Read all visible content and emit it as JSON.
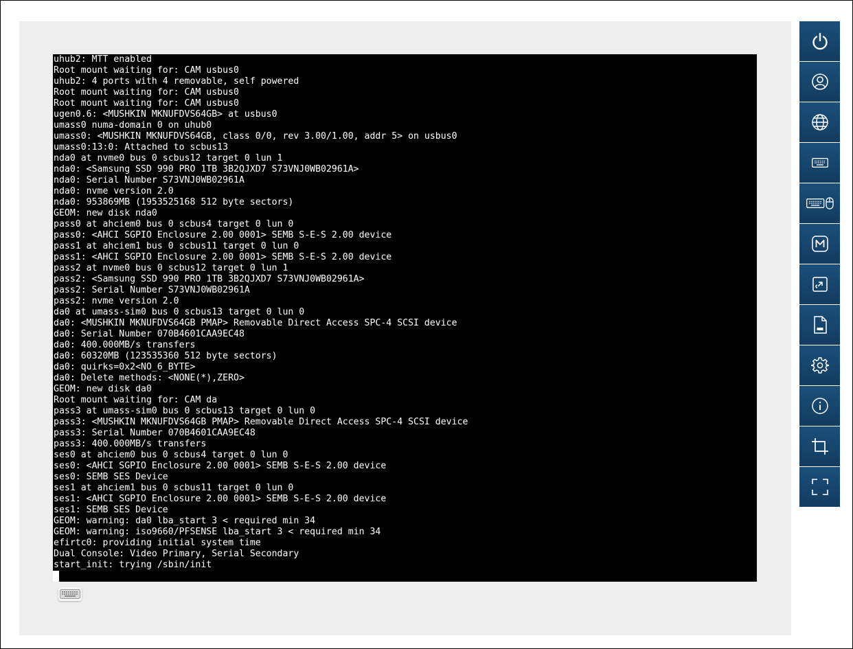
{
  "console": {
    "lines": [
      "uhub2: MTT enabled",
      "Root mount waiting for: CAM usbus0",
      "uhub2: 4 ports with 4 removable, self powered",
      "Root mount waiting for: CAM usbus0",
      "Root mount waiting for: CAM usbus0",
      "ugen0.6: <MUSHKIN MKNUFDVS64GB> at usbus0",
      "umass0 numa-domain 0 on uhub0",
      "umass0: <MUSHKIN MKNUFDVS64GB, class 0/0, rev 3.00/1.00, addr 5> on usbus0",
      "umass0:13:0: Attached to scbus13",
      "nda0 at nvme0 bus 0 scbus12 target 0 lun 1",
      "nda0: <Samsung SSD 990 PRO 1TB 3B2QJXD7 S73VNJ0WB02961A>",
      "nda0: Serial Number S73VNJ0WB02961A",
      "nda0: nvme version 2.0",
      "nda0: 953869MB (1953525168 512 byte sectors)",
      "GEOM: new disk nda0",
      "pass0 at ahciem0 bus 0 scbus4 target 0 lun 0",
      "pass0: <AHCI SGPIO Enclosure 2.00 0001> SEMB S-E-S 2.00 device",
      "pass1 at ahciem1 bus 0 scbus11 target 0 lun 0",
      "pass1: <AHCI SGPIO Enclosure 2.00 0001> SEMB S-E-S 2.00 device",
      "pass2 at nvme0 bus 0 scbus12 target 0 lun 1",
      "pass2: <Samsung SSD 990 PRO 1TB 3B2QJXD7 S73VNJ0WB02961A>",
      "pass2: Serial Number S73VNJ0WB02961A",
      "pass2: nvme version 2.0",
      "da0 at umass-sim0 bus 0 scbus13 target 0 lun 0",
      "da0: <MUSHKIN MKNUFDVS64GB PMAP> Removable Direct Access SPC-4 SCSI device",
      "da0: Serial Number 070B4601CAA9EC48",
      "da0: 400.000MB/s transfers",
      "da0: 60320MB (123535360 512 byte sectors)",
      "da0: quirks=0x2<NO_6_BYTE>",
      "da0: Delete methods: <NONE(*),ZERO>",
      "GEOM: new disk da0",
      "Root mount waiting for: CAM da",
      "pass3 at umass-sim0 bus 0 scbus13 target 0 lun 0",
      "pass3: <MUSHKIN MKNUFDVS64GB PMAP> Removable Direct Access SPC-4 SCSI device",
      "pass3: Serial Number 070B4601CAA9EC48",
      "pass3: 400.000MB/s transfers",
      "ses0 at ahciem0 bus 0 scbus4 target 0 lun 0",
      "ses0: <AHCI SGPIO Enclosure 2.00 0001> SEMB S-E-S 2.00 device",
      "ses0: SEMB SES Device",
      "ses1 at ahciem1 bus 0 scbus11 target 0 lun 0",
      "ses1: <AHCI SGPIO Enclosure 2.00 0001> SEMB S-E-S 2.00 device",
      "ses1: SEMB SES Device",
      "GEOM: warning: da0 lba_start 3 < required min 34",
      "GEOM: warning: iso9660/PFSENSE lba_start 3 < required min 34",
      "efirtc0: providing initial system time",
      "Dual Console: Video Primary, Serial Secondary",
      "start_init: trying /sbin/init"
    ]
  },
  "toolbar": {
    "buttons": [
      {
        "icon": "power-icon"
      },
      {
        "icon": "user-icon"
      },
      {
        "icon": "globe-icon"
      },
      {
        "icon": "keyboard-icon"
      },
      {
        "icon": "keyboard-mouse-icon"
      },
      {
        "icon": "macro-icon"
      },
      {
        "icon": "launch-icon"
      },
      {
        "icon": "iso-file-icon"
      },
      {
        "icon": "gear-icon"
      },
      {
        "icon": "info-icon"
      },
      {
        "icon": "crop-icon"
      },
      {
        "icon": "fullscreen-icon"
      }
    ]
  },
  "colors": {
    "toolbar_bg": "#123c60",
    "terminal_bg": "#000000",
    "terminal_fg": "#ffffff",
    "panel_bg": "#eeeeee"
  }
}
